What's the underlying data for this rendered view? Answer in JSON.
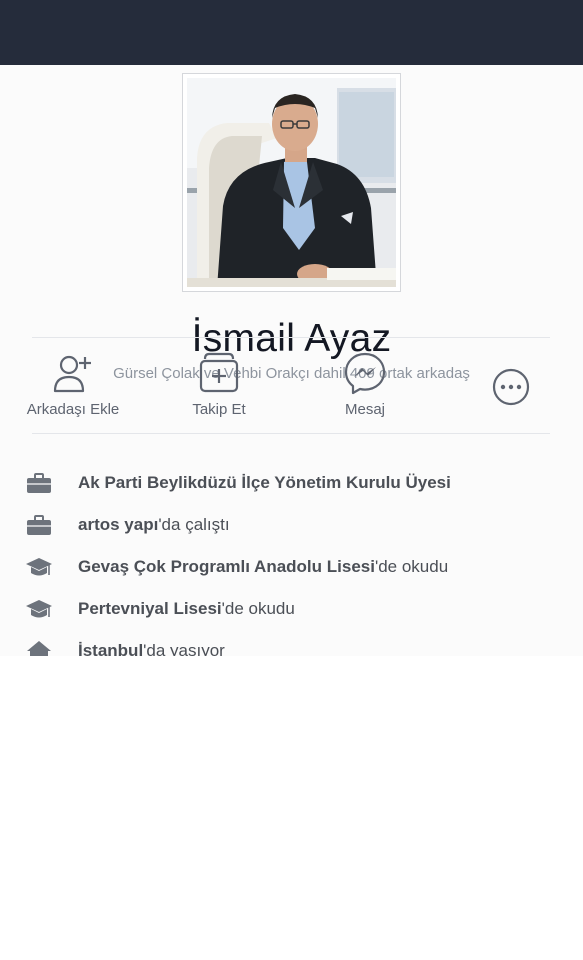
{
  "profile": {
    "name": "İsmail Ayaz",
    "mutual_friends": "Gürsel Çolak ve Vehbi Orakçı dahil 409 ortak arkadaş"
  },
  "actions": [
    {
      "label": "Arkadaşı Ekle",
      "icon": "add-friend-icon"
    },
    {
      "label": "Takip Et",
      "icon": "follow-icon"
    },
    {
      "label": "Mesaj",
      "icon": "messenger-icon"
    },
    {
      "label": "",
      "icon": "more-icon"
    }
  ],
  "info": [
    {
      "icon": "briefcase-icon",
      "bold": "Ak Parti Beylikdüzü İlçe Yönetim Kurulu Üyesi",
      "rest": ""
    },
    {
      "icon": "briefcase-icon",
      "bold": "artos yapı",
      "rest": "'da çalıştı"
    },
    {
      "icon": "graduation-cap-icon",
      "bold": "Gevaş Çok Programlı Anadolu Lisesi",
      "rest": "'de okudu"
    },
    {
      "icon": "graduation-cap-icon",
      "bold": "Pertevniyal Lisesi",
      "rest": "'de okudu"
    },
    {
      "icon": "home-icon",
      "bold": "İstanbul",
      "rest": "'da yaşıyor"
    }
  ],
  "colors": {
    "cover": "#252c3b",
    "text_dark": "#141823",
    "text_muted": "#8d949e",
    "icon_gray": "#5e6470"
  }
}
